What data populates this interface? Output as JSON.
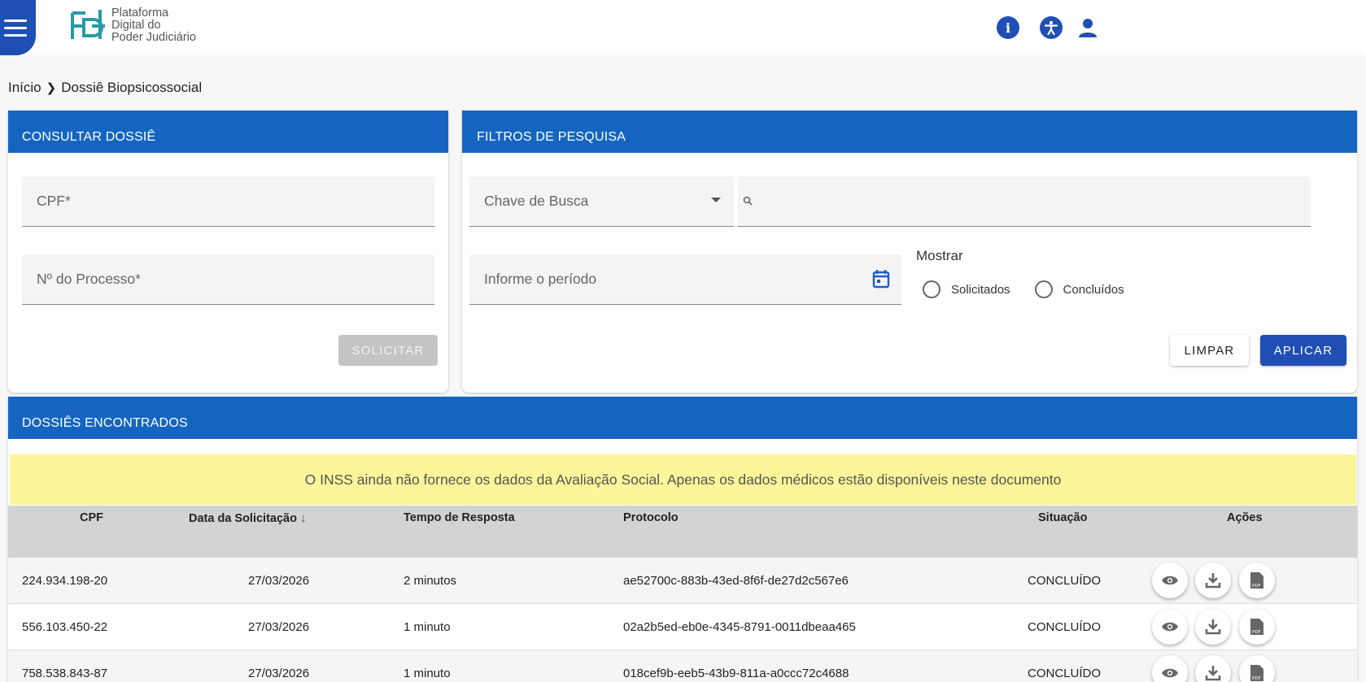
{
  "header": {
    "logo_text": "Plataforma\nDigital do\nPoder Judiciário",
    "icons": [
      "info-icon",
      "accessibility-icon",
      "user-icon"
    ]
  },
  "breadcrumb": {
    "home": "Início",
    "separator": ">",
    "current": "Dossiê Biopsicossocial"
  },
  "consultar": {
    "title": "CONSULTAR DOSSIÊ",
    "cpf_label": "CPF*",
    "processo_label": "Nº do Processo*",
    "solicitar_label": "SOLICITAR"
  },
  "filtros": {
    "title": "FILTROS DE PESQUISA",
    "chave_label": "Chave de Busca",
    "periodo_label": "Informe o período",
    "mostrar_label": "Mostrar",
    "radio_solicitados": "Solicitados",
    "radio_concluidos": "Concluídos",
    "limpar_label": "LIMPAR",
    "aplicar_label": "APLICAR"
  },
  "resultados": {
    "title": "DOSSIÊS ENCONTRADOS",
    "notice": "O INSS ainda não fornece os dados da Avaliação Social. Apenas os dados médicos estão disponíveis neste documento",
    "columns": {
      "cpf": "CPF",
      "data": "Data da Solicitação",
      "tempo": "Tempo de Resposta",
      "protocolo": "Protocolo",
      "situacao": "Situação",
      "acoes": "Ações"
    },
    "rows": [
      {
        "cpf": "224.934.198-20",
        "data": "27/03/2026",
        "tempo": "2 minutos",
        "protocolo": "ae52700c-883b-43ed-8f6f-de27d2c567e6",
        "situacao": "CONCLUÍDO"
      },
      {
        "cpf": "556.103.450-22",
        "data": "27/03/2026",
        "tempo": "1 minuto",
        "protocolo": "02a2b5ed-eb0e-4345-8791-0011dbeaa465",
        "situacao": "CONCLUÍDO"
      },
      {
        "cpf": "758.538.843-87",
        "data": "27/03/2026",
        "tempo": "1 minuto",
        "protocolo": "018cef9b-eeb5-43b9-811a-a0ccc72c4688",
        "situacao": "CONCLUÍDO"
      }
    ]
  },
  "colors": {
    "brand_blue": "#1565c0",
    "header_blue": "#1f4fb5",
    "notice_yellow": "#fef59a"
  }
}
